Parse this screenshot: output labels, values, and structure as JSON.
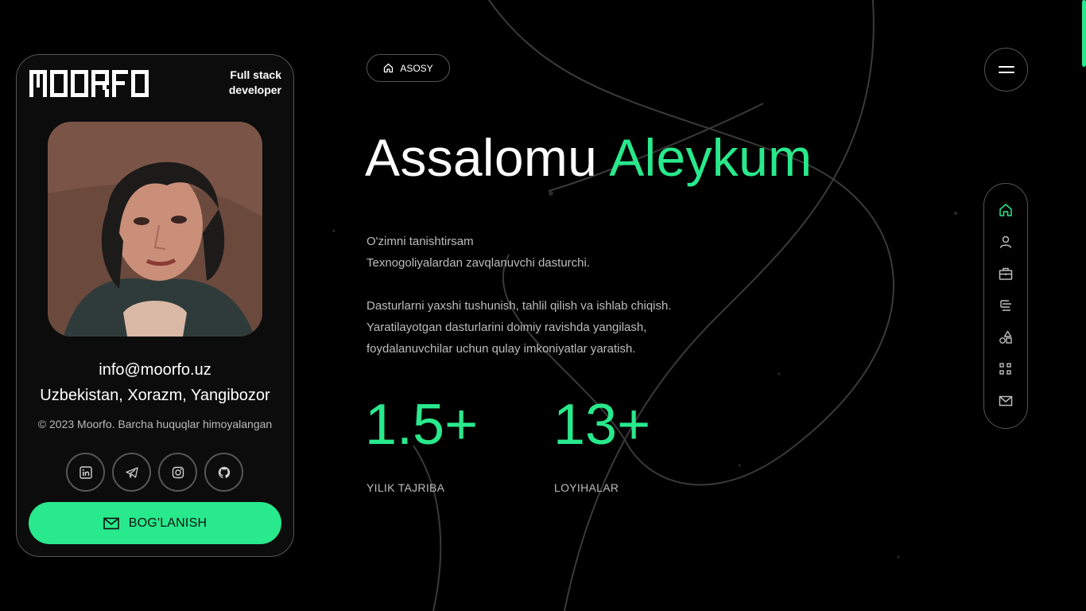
{
  "colors": {
    "accent": "#28e98c",
    "background": "#000000",
    "border": "#565656"
  },
  "card": {
    "logo_text": "MOORFO",
    "role_line1": "Full stack",
    "role_line2": "developer",
    "email": "info@moorfo.uz",
    "address": "Uzbekistan, Xorazm, Yangibozor",
    "copyright": "© 2023 Moorfo. Barcha huquqlar himoyalangan",
    "socials": [
      "linkedin-icon",
      "telegram-icon",
      "instagram-icon",
      "github-icon"
    ],
    "contact_label": "BOG'LANISH"
  },
  "main": {
    "badge": "ASOSY",
    "title_part1": "Assalomu",
    "title_part2": "Aleykum",
    "intro": [
      "O'zimni tanishtirsam",
      "Texnogoliyalardan zavqlanuvchi dasturchi.",
      "Dasturlarni yaxshi tushunish, tahlil qilish va ishlab chiqish.",
      "Yaratilayotgan dasturlarini doimiy ravishda yangilash,",
      "foydalanuvchilar uchun qulay imkoniyatlar yaratish."
    ],
    "stats": [
      {
        "number": "1.5+",
        "label": "YILIK TAJRIBA"
      },
      {
        "number": "13+",
        "label": "LOYIHALAR"
      }
    ]
  },
  "nav": {
    "items": [
      "home-icon",
      "user-icon",
      "briefcase-icon",
      "resume-icon",
      "shapes-icon",
      "grid-icon",
      "mail-icon"
    ],
    "active": "home-icon"
  }
}
